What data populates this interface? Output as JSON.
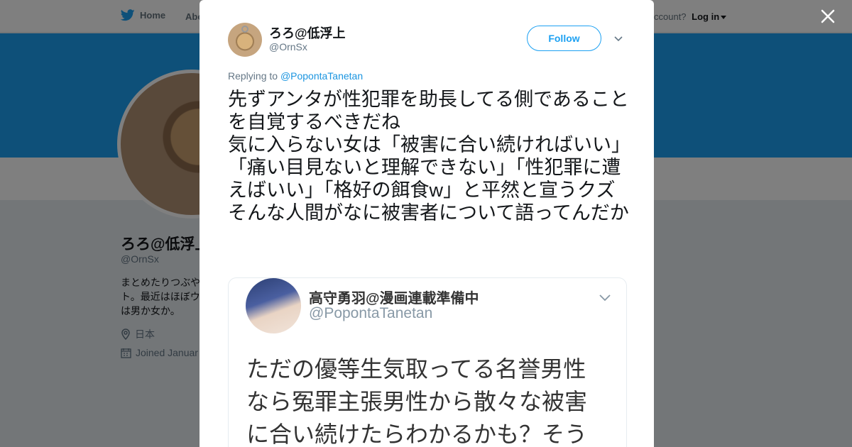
{
  "nav": {
    "home_label": "Home",
    "about_label": "Abo",
    "account_prompt": "ccount?",
    "login_label": "Log in"
  },
  "profile": {
    "name": "ろろ@低浮上",
    "handle": "@OrnSx",
    "bio": "まとめたりつぶやト。最近はほぼウは男か女か。",
    "location": "日本",
    "joined": "Joined Januar"
  },
  "tweet": {
    "author_name": "ろろ@低浮上",
    "author_handle": "@OrnSx",
    "follow_label": "Follow",
    "replying_prefix": "Replying to",
    "replying_to": "@PopontaTanetan",
    "text": "先ずアンタが性犯罪を助長してる側であることを自覚するべきだね\n気に入らない女は「被害に合い続ければいい」「痛い目見ないと理解できない」「性犯罪に遭えばいい」「格好の餌食w」と平然と宣うクズ\nそんな人間がなに被害者について語ってんだか"
  },
  "media": {
    "name": "高守勇羽@漫画連載準備中",
    "handle": "@PopontaTanetan",
    "text": "ただの優等生気取ってる名誉男性\nなら冤罪主張男性から散々な被害\nに合い続けたらわかるかも？そう"
  },
  "icons": {
    "twitter": "twitter-bird-icon",
    "close": "close-icon",
    "chevron": "chevron-down-icon",
    "location": "location-pin-icon",
    "calendar": "calendar-icon"
  },
  "colors": {
    "accent": "#1da1f2",
    "link": "#1b95e0",
    "text": "#14171a",
    "muted": "#657786"
  }
}
